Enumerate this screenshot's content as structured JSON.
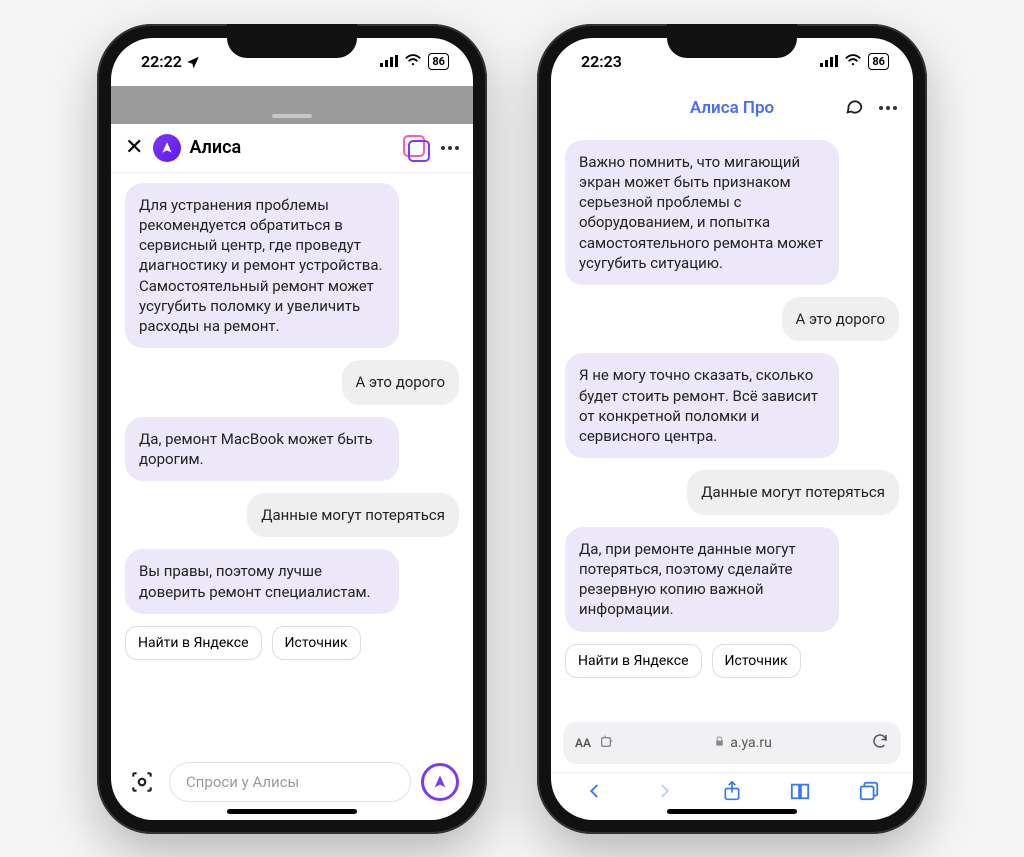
{
  "phone1": {
    "status": {
      "time": "22:22",
      "battery": "86"
    },
    "header": {
      "title": "Алиса"
    },
    "messages": [
      {
        "role": "bot",
        "text": "Для устранения проблемы рекомендуется обратиться в сервисный центр, где проведут диагностику и ремонт устройства. Самостоятельный ремонт может усугубить поломку и увеличить расходы на ремонт."
      },
      {
        "role": "user",
        "text": "А это дорого"
      },
      {
        "role": "bot",
        "text": "Да, ремонт MacBook может быть дорогим."
      },
      {
        "role": "user",
        "text": "Данные могут потеряться"
      },
      {
        "role": "bot",
        "text": "Вы правы, поэтому лучше доверить ремонт специалистам."
      }
    ],
    "chips": [
      "Найти в Яндексе",
      "Источник"
    ],
    "composer": {
      "placeholder": "Спроси у Алисы"
    }
  },
  "phone2": {
    "status": {
      "time": "22:23",
      "battery": "86"
    },
    "header": {
      "title": "Алиса Про"
    },
    "messages": [
      {
        "role": "bot",
        "text": "Важно помнить, что мигающий экран может быть признаком серьезной проблемы с оборудованием, и попытка самостоятельного ремонта может усугубить ситуацию."
      },
      {
        "role": "user",
        "text": "А это дорого"
      },
      {
        "role": "bot",
        "text": "Я не могу точно сказать, сколько будет стоить ремонт. Всё зависит от конкретной поломки и сервисного центра."
      },
      {
        "role": "user",
        "text": "Данные могут потеряться"
      },
      {
        "role": "bot",
        "text": "Да, при ремонте данные могут потеряться, поэтому сделайте резервную копию важной информации."
      }
    ],
    "chips": [
      "Найти в Яндексе",
      "Источник"
    ],
    "urlbar": {
      "left": "AA",
      "domain": "a.ya.ru"
    }
  }
}
